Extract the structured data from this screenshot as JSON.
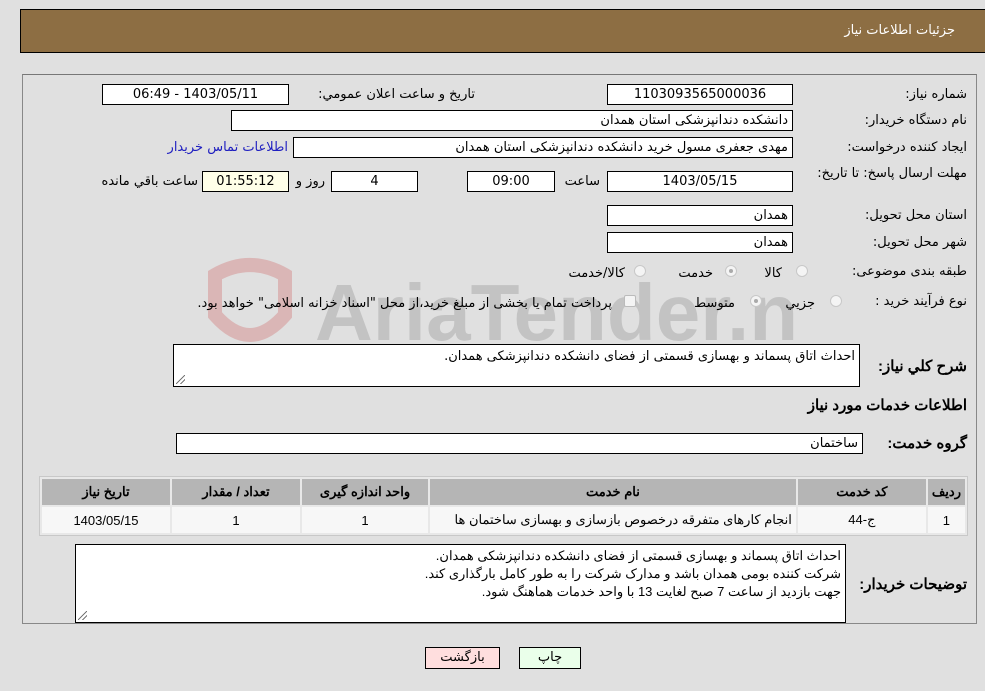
{
  "header": {
    "title": "جزئیات اطلاعات نیاز"
  },
  "form": {
    "need_number": {
      "label": "شماره نیاز:",
      "value": "1103093565000036"
    },
    "announce_datetime": {
      "label": "تاریخ و ساعت اعلان عمومي:",
      "value": "1403/05/11 - 06:49"
    },
    "buyer_org": {
      "label": "نام دستگاه خریدار:",
      "value": "دانشکده دندانپزشکی استان همدان"
    },
    "requester": {
      "label": "ایجاد کننده درخواست:",
      "value": "مهدی جعفری مسول خرید دانشکده دندانپزشکی استان همدان"
    },
    "buyer_contact_link": "اطلاعات تماس خریدار",
    "deadline": {
      "label": "مهلت ارسال پاسخ: تا تاریخ:",
      "date": "1403/05/15",
      "time_label": "ساعت",
      "time": "09:00",
      "days": "4",
      "days_label": "روز و",
      "remaining": "01:55:12",
      "remaining_label": "ساعت باقي مانده"
    },
    "delivery_province": {
      "label": "استان محل تحویل:",
      "value": "همدان"
    },
    "delivery_city": {
      "label": "شهر محل تحویل:",
      "value": "همدان"
    },
    "category": {
      "label": "طبقه بندی موضوعی:",
      "options": [
        "کالا",
        "خدمت",
        "کالا/خدمت"
      ],
      "selected": "خدمت"
    },
    "purchase_type": {
      "label": "نوع فرآیند خرید :",
      "options": [
        "جزيي",
        "متوسط"
      ],
      "selected": "متوسط",
      "treasury_note": "پرداخت تمام یا بخشی از مبلغ خرید،از محل \"اسناد خزانه اسلامی\" خواهد بود."
    },
    "general_description": {
      "label": "شرح کلي نیاز:",
      "value": "احداث اتاق پسماند و بهسازی قسمتی از فضای دانشکده دندانپزشکی همدان."
    },
    "services_section_title": "اطلاعات خدمات مورد نیاز",
    "service_group": {
      "label": "گروه خدمت:",
      "value": "ساختمان"
    }
  },
  "services_table": {
    "headers": [
      "ردیف",
      "کد خدمت",
      "نام خدمت",
      "واحد اندازه گیری",
      "تعداد / مقدار",
      "تاریخ نیاز"
    ],
    "rows": [
      [
        "1",
        "ج-44",
        "انجام کارهای متفرقه درخصوص بازسازی و بهسازی ساختمان ها",
        "1",
        "1",
        "1403/05/15"
      ]
    ]
  },
  "buyer_notes": {
    "label": "توضیحات خریدار:",
    "lines": [
      "احداث اتاق پسماند و بهسازی قسمتی از فضای دانشکده دندانپزشکی همدان.",
      "شرکت کننده بومی همدان باشد و مدارک شرکت را به طور کامل بارگذاری کند.",
      "جهت بازدید از ساعت 7 صبح لغایت 13 با واحد خدمات هماهنگ شود."
    ]
  },
  "buttons": {
    "print": "چاپ",
    "back": "بازگشت"
  },
  "watermark": {
    "text": "AriaTender.neT"
  },
  "colors": {
    "header_bg": "#8d6e43",
    "print_bg": "#eaffea",
    "back_bg": "#ffdede",
    "link": "#2020c0"
  }
}
